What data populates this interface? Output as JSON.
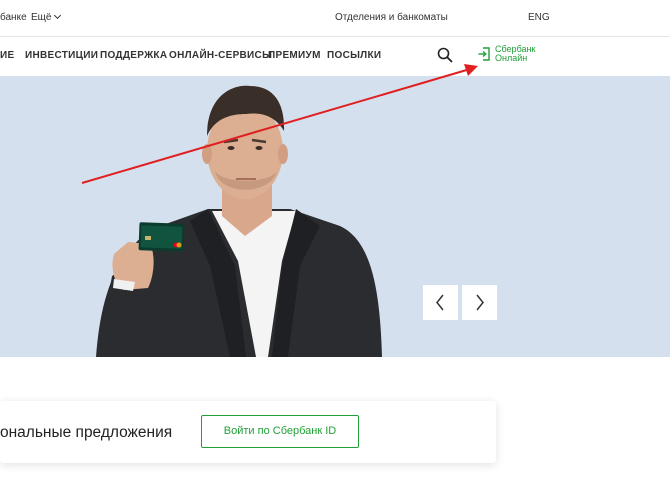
{
  "topbar": {
    "about": "банке",
    "more": "Ещё",
    "branches": "Отделения и банкоматы",
    "lang": "ENG"
  },
  "nav": {
    "items": [
      "ИЕ",
      "ИНВЕСТИЦИИ",
      "ПОДДЕРЖКА",
      "ОНЛАЙН-СЕРВИСЫ",
      "ПРЕМИУМ",
      "ПОСЫЛКИ"
    ],
    "online_line1": "Сбербанк",
    "online_line2": "Онлайн"
  },
  "hero": {
    "prev_icon": "chevron-left-icon",
    "next_icon": "chevron-right-icon"
  },
  "offer": {
    "title": "ональные предложения",
    "button": "Войти по Сбербанк ID"
  },
  "colors": {
    "brand_green": "#21a038",
    "hero_bg": "#d5e0ee",
    "annotation_red": "#e02020"
  }
}
